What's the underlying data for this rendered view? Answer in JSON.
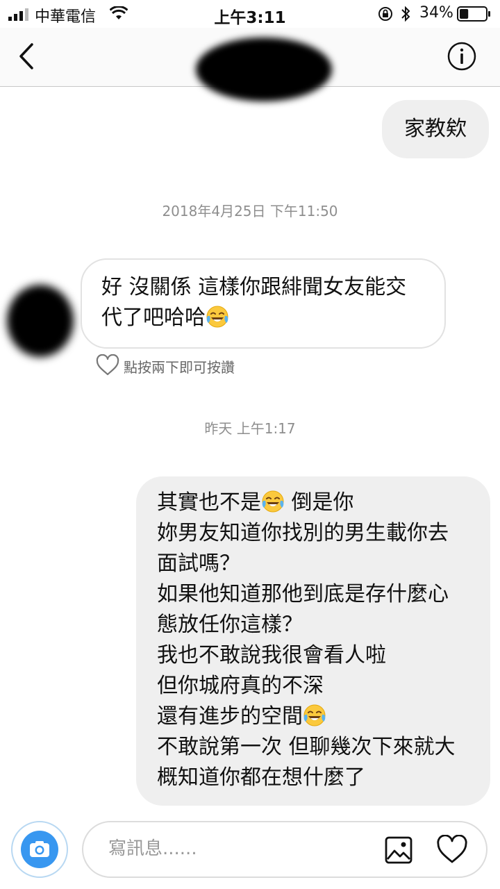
{
  "status_bar": {
    "carrier": "中華電信",
    "time": "上午3:11",
    "battery": "34%",
    "battery_level": 0.34
  },
  "nav": {
    "back_icon": "chevron-left-icon",
    "info_icon": "info-icon"
  },
  "messages": [
    {
      "direction": "outgoing",
      "lines": [
        "家教欸"
      ]
    },
    {
      "direction": "incoming",
      "lines": [
        "好 沒關係 這樣你跟緋聞女友能交",
        "代了吧哈哈"
      ]
    },
    {
      "direction": "outgoing",
      "lines": [
        "其實也不是",
        "倒是你",
        "妳男友知道你找別的男生載你去",
        "面試嗎？",
        "如果他知道那他到底是存什麼心",
        "態放任你這樣？",
        "我也不敢說我很會看人啦",
        "但你城府真的不深",
        "還有進步的空間",
        "不敢說第一次 但聊幾次下來就大",
        "概知道你都在想什麼了"
      ]
    }
  ],
  "timestamps": [
    "2018年4月25日 下午11:50",
    "昨天 上午1:17"
  ],
  "like_hint": "點按兩下即可按讚",
  "composer": {
    "placeholder": "寫訊息......"
  },
  "emoji": "face-with-tears-of-joy",
  "colors": {
    "accent": "#3897f0",
    "outgoing_bubble": "#efefef",
    "timestamp": "#8e8e8e"
  }
}
